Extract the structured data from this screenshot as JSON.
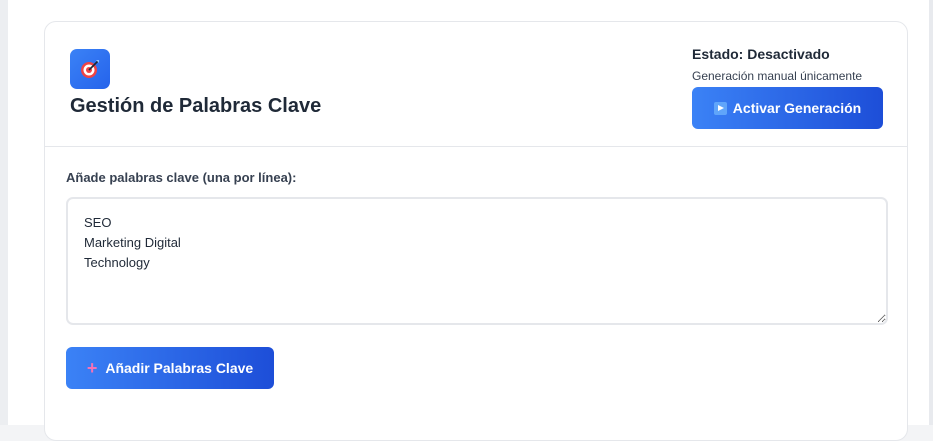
{
  "header": {
    "title": "Gestión de Palabras Clave",
    "app_icon": "target-dart-icon",
    "status_label": "Estado: Desactivado",
    "status_subtext": "Generación manual únicamente",
    "activate_button_label": "Activar Generación",
    "activate_button_icon": "play-icon"
  },
  "form": {
    "label": "Añade palabras clave (una por línea):",
    "keywords_value": "SEO\nMarketing Digital\nTechnology",
    "add_button_label": "Añadir Palabras Clave",
    "add_button_icon": "plus-icon"
  },
  "colors": {
    "accent": "#3b82f6",
    "accent_dark": "#1d4ed8"
  }
}
